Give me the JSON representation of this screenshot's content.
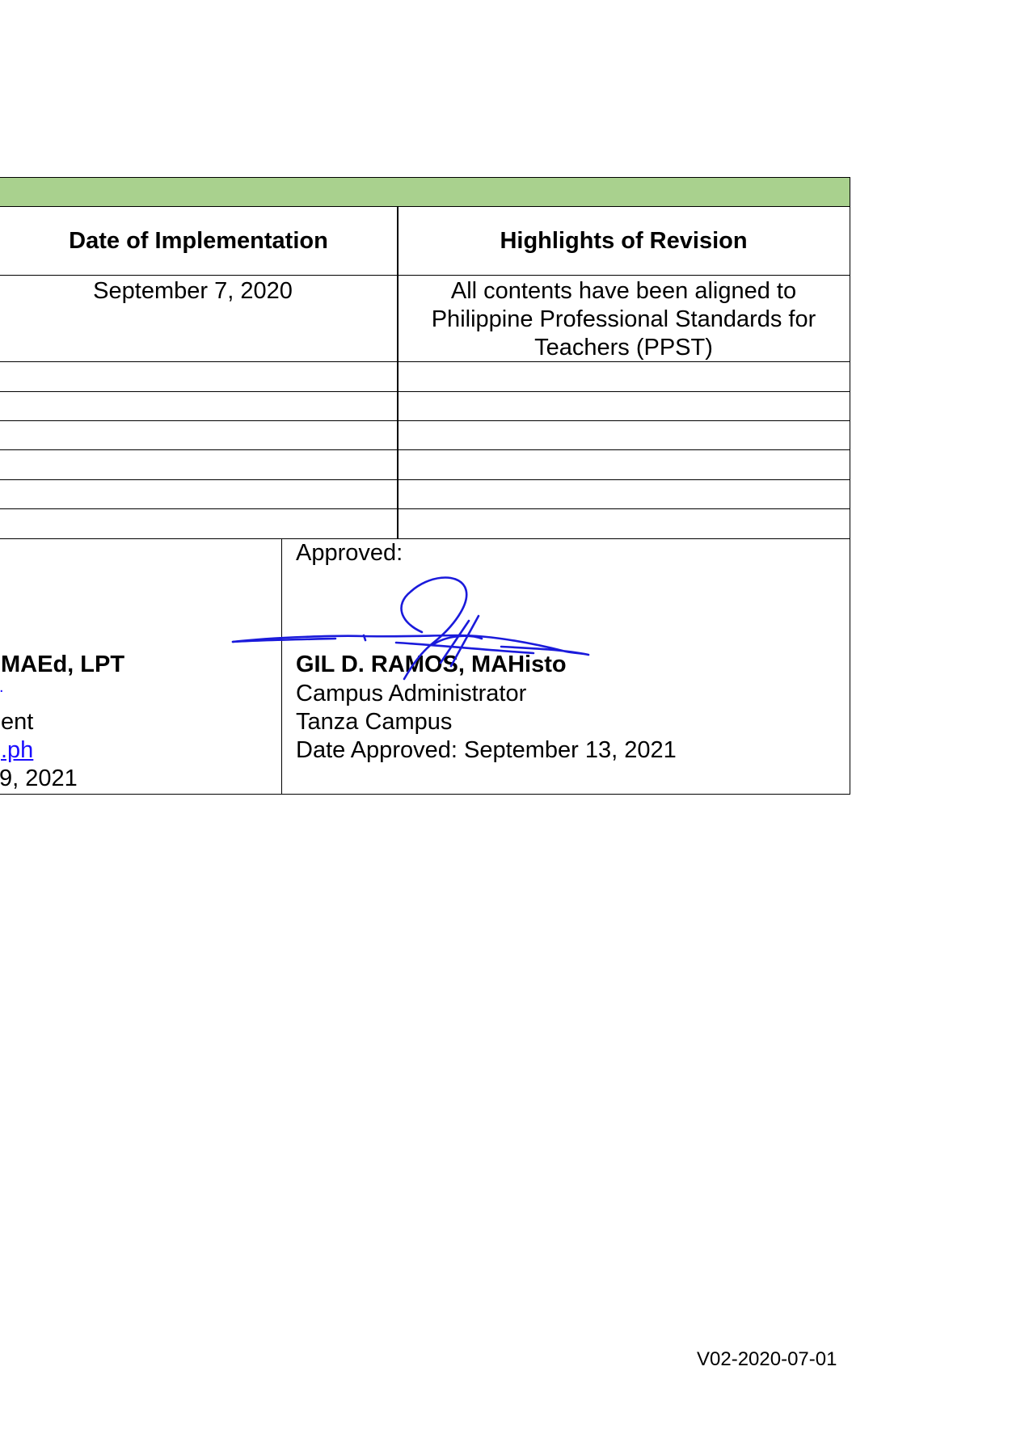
{
  "table": {
    "header_date": "Date of Implementation",
    "header_highlights": "Highlights of Revision",
    "row1_date": "September 7, 2020",
    "row1_highlights": [
      "All contents have been aligned to",
      "Philippine Professional Standards for",
      "Teachers (PPST)"
    ]
  },
  "signatures": {
    "left": {
      "name_fragment": "MAEd, LPT",
      "dot": ".",
      "line3_fragment": "ent",
      "email_fragment": ".ph",
      "date_fragment": "9, 2021"
    },
    "right": {
      "label": "Approved:",
      "name": "GIL D. RAMOS, MAHisto",
      "title": "Campus Administrator",
      "campus": "Tanza Campus",
      "date_approved": "Date Approved:  September 13, 2021"
    }
  },
  "footer": {
    "code": "V02-2020-07-01"
  },
  "colors": {
    "header_bar": "#a9d18e",
    "link": "#1a0dff",
    "signature_ink": "#1a1adb"
  }
}
